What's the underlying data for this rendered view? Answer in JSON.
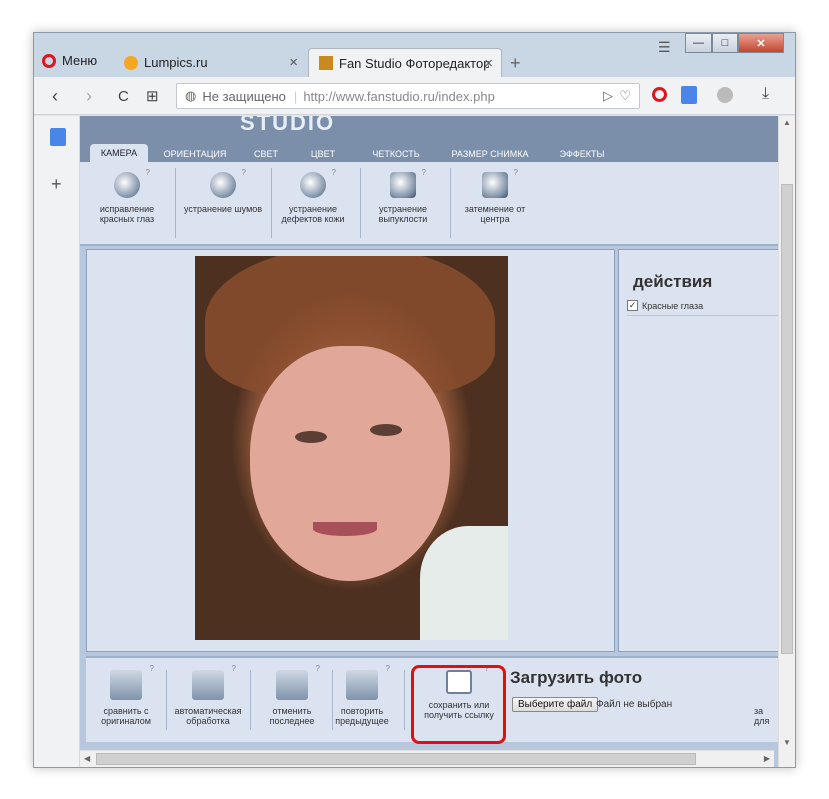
{
  "browser": {
    "menu_label": "Меню",
    "tabs": [
      {
        "label": "Lumpics.ru",
        "close": "×"
      },
      {
        "label": "Fan Studio Фоторедактор",
        "close": "×"
      }
    ],
    "new_tab": "+",
    "window_controls": {
      "minimize": "—",
      "maximize": "□",
      "close": "✕"
    },
    "nav": {
      "back": "‹",
      "forward": "›",
      "reload": "C",
      "grid": "⊞"
    },
    "security_label": "Не защищено",
    "url": "http://www.fanstudio.ru/index.php",
    "url_host": "www.fanstudio.ru"
  },
  "sidebar": {
    "add": "+"
  },
  "site": {
    "logo_text": "STUDIO",
    "tabs": [
      "КАМЕРА",
      "ОРИЕНТАЦИЯ",
      "СВЕТ",
      "ЦВЕТ",
      "ЧЕТКОСТЬ",
      "РАЗМЕР СНИМКА",
      "ЭФФЕКТЫ"
    ],
    "active_tab": "КАМЕРА",
    "tools": [
      {
        "label": "исправление красных глаз",
        "icon": "red-eye-icon"
      },
      {
        "label": "устранение шумов",
        "icon": "noise-icon"
      },
      {
        "label": "устранение дефектов кожи",
        "icon": "skin-icon"
      },
      {
        "label": "устранение выпуклости",
        "icon": "bulge-icon"
      },
      {
        "label": "затемнение от центра",
        "icon": "vignette-icon"
      }
    ],
    "help_mark": "?",
    "actions_panel": {
      "title": "действия",
      "items": [
        {
          "label": "Красные глаза",
          "checked": true
        }
      ]
    },
    "bottom_tools": [
      {
        "label": "сравнить с оригиналом",
        "icon": "compare-icon"
      },
      {
        "label": "автоматическая обработка",
        "icon": "auto-icon"
      },
      {
        "label": "отменить последнее",
        "icon": "undo-icon"
      },
      {
        "label": "повторить предыдущее",
        "icon": "redo-icon"
      },
      {
        "label": "сохранить или получить ссылку",
        "icon": "save-icon"
      }
    ],
    "upload": {
      "title": "Загрузить фото",
      "button": "Выберите файл",
      "status": "Файл не выбран",
      "next_label": "за для"
    }
  },
  "colors": {
    "site_bg": "#b7c7dd",
    "panel_bg": "#dbe3f1",
    "highlight": "#e01010",
    "opera_red": "#e2131f"
  }
}
